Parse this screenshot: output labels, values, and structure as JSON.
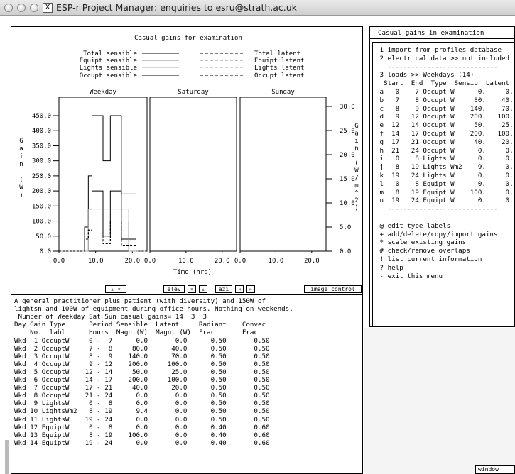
{
  "window": {
    "title": "ESP-r Project Manager: enquiries to esru@strath.ac.uk",
    "x_icon": "X"
  },
  "graph": {
    "title": "Casual gains for examination",
    "legend_left": [
      "Total sensible",
      "Equipt sensible",
      "Lights sensible",
      "Occupt sensible"
    ],
    "legend_right": [
      "Total latent",
      "Equipt latent",
      "Lights latent",
      "Occupt latent"
    ],
    "panels": [
      "Weekday",
      "Saturday",
      "Sunday"
    ],
    "y_left_label": [
      "G",
      "a",
      "i",
      "n",
      "",
      "(",
      "W",
      ")"
    ],
    "y_right_label": [
      "G",
      "a",
      "i",
      "n",
      "",
      "(",
      "W",
      "/",
      "m",
      "^",
      "2",
      ")"
    ],
    "y_left_ticks": [
      "450.0",
      "400.0",
      "350.0",
      "300.0",
      "250.0",
      "200.0",
      "150.0",
      "100.0",
      "50.0",
      "0.0"
    ],
    "y_right_ticks": [
      "30.0",
      "25.0",
      "20.0",
      "15.0",
      "10.0",
      "5.0",
      "0.0"
    ],
    "x_ticks": [
      "0.0",
      "10.0",
      "20.0"
    ],
    "xlabel": "Time (hrs)"
  },
  "chart_data": {
    "type": "line",
    "title": "Casual gains for examination",
    "xlabel": "Time (hrs)",
    "ylabel": "Gain (W)",
    "y2label": "Gain (W/m^2)",
    "ylim": [
      0,
      450
    ],
    "y2lim": [
      0,
      30
    ],
    "xlim": [
      0,
      24
    ],
    "panels": [
      "Weekday",
      "Saturday",
      "Sunday"
    ],
    "series": [
      {
        "name": "Total sensible",
        "panel": "Weekday",
        "x": [
          0,
          7,
          7,
          8,
          8,
          9,
          9,
          12,
          12,
          14,
          14,
          17,
          17,
          21,
          21,
          24
        ],
        "y": [
          0,
          0,
          80,
          80,
          250,
          250,
          450,
          450,
          300,
          300,
          450,
          450,
          190,
          190,
          0,
          0
        ]
      },
      {
        "name": "Occupt sensible",
        "panel": "Weekday",
        "x": [
          0,
          7,
          7,
          8,
          8,
          9,
          9,
          12,
          12,
          14,
          14,
          17,
          17,
          21,
          21,
          24
        ],
        "y": [
          0,
          0,
          80,
          80,
          140,
          140,
          200,
          200,
          50,
          50,
          200,
          200,
          40,
          40,
          0,
          0
        ]
      },
      {
        "name": "Equipt sensible",
        "panel": "Weekday",
        "x": [
          0,
          8,
          8,
          19,
          19,
          24
        ],
        "y": [
          0,
          0,
          100,
          100,
          0,
          0
        ]
      },
      {
        "name": "Lights sensible",
        "panel": "Weekday",
        "x": [
          0,
          8,
          8,
          19,
          19,
          24
        ],
        "y": [
          0,
          0,
          140,
          140,
          0,
          0
        ]
      },
      {
        "name": "Total latent",
        "panel": "Weekday",
        "x": [
          0,
          7,
          7,
          8,
          8,
          9,
          9,
          12,
          12,
          14,
          14,
          17,
          17,
          21,
          21,
          24
        ],
        "y": [
          0,
          0,
          40,
          40,
          70,
          70,
          100,
          100,
          25,
          25,
          100,
          100,
          20,
          20,
          0,
          0
        ]
      },
      {
        "name": "Occupt latent",
        "panel": "Weekday",
        "x": [
          0,
          7,
          7,
          8,
          8,
          9,
          9,
          12,
          12,
          14,
          14,
          17,
          17,
          21,
          21,
          24
        ],
        "y": [
          0,
          0,
          40,
          40,
          70,
          70,
          100,
          100,
          25,
          25,
          100,
          100,
          20,
          20,
          0,
          0
        ]
      }
    ]
  },
  "controls": {
    "updown": "▵ ▿",
    "elev": "elev",
    "elev_down": "▿",
    "elev_up": "▵",
    "azi": "azi",
    "azi_left": "◃",
    "azi_right": "▹",
    "image_control": "image control"
  },
  "text_panel": {
    "lines": [
      "A general practitioner plus patient (with diversity) and 150W of",
      "lightsn and 100W of equipment during office hours. Nothing on weekends.",
      " Number of Weekday Sat Sun casual gains= 14  3  3",
      "Day Gain Type      Period Sensible  Latent     Radiant    Convec",
      "    No.  labl      Hours  Magn.(W)  Magn. (W)  Frac       Frac",
      "Wkd  1 OccuptW     0 -  7      0.0       0.0      0.50       0.50",
      "Wkd  2 OccuptW     7 -  8     80.0      40.0      0.50       0.50",
      "Wkd  3 OccuptW     8 -  9    140.0      70.0      0.50       0.50",
      "Wkd  4 OccuptW     9 - 12    200.0     100.0      0.50       0.50",
      "Wkd  5 OccuptW    12 - 14     50.0      25.0      0.50       0.50",
      "Wkd  6 OccuptW    14 - 17    200.0     100.0      0.50       0.50",
      "Wkd  7 OccuptW    17 - 21     40.0      20.0      0.50       0.50",
      "Wkd  8 OccuptW    21 - 24      0.0       0.0      0.50       0.50",
      "Wkd  9 LightsW     0 -  8      0.0       0.0      0.50       0.50",
      "Wkd 10 LightsWm2   8 - 19      9.4       0.0      0.50       0.50",
      "Wkd 11 LightsW    19 - 24      0.0       0.0      0.50       0.50",
      "Wkd 12 EquiptW     0 -  8      0.0       0.0      0.40       0.60",
      "Wkd 13 EquiptW     8 - 19    100.0       0.0      0.40       0.60",
      "Wkd 14 EquiptW    19 - 24      0.0       0.0      0.40       0.60"
    ]
  },
  "menu": {
    "header": "Casual gains in examination",
    "items": [
      " 1 import from profiles database",
      " 2 electrical data >> not included",
      "   ----------------------------",
      " 3 loads >> Weekdays (14)",
      "  Start  End  Type  Sensib  Latent",
      " a   0    7 Occupt W      0.     0.",
      " b   7    8 Occupt W     80.    40.",
      " c   8    9 Occupt W    140.    70.",
      " d   9   12 Occupt W    200.   100.",
      " e  12   14 Occupt W     50.    25.",
      " f  14   17 Occupt W    200.   100.",
      " g  17   21 Occupt W     40.    20.",
      " h  21   24 Occupt W      0.     0.",
      " i   0    8 Lights W      0.     0.",
      " j   8   19 Lights Wm2    9.     0.",
      " k  19   24 Lights W      0.     0.",
      " l   0    8 Equipt W      0.     0.",
      " m   8   19 Equipt W    100.     0.",
      " n  19   24 Equipt W      0.     0.",
      "   ----------------------------",
      "",
      " @ edit type labels",
      " + add/delete/copy/import gains",
      " * scale existing gains",
      " # check/remove overlaps",
      " ! list current information",
      " ? help",
      " - exit this menu"
    ]
  },
  "window_button": "window"
}
